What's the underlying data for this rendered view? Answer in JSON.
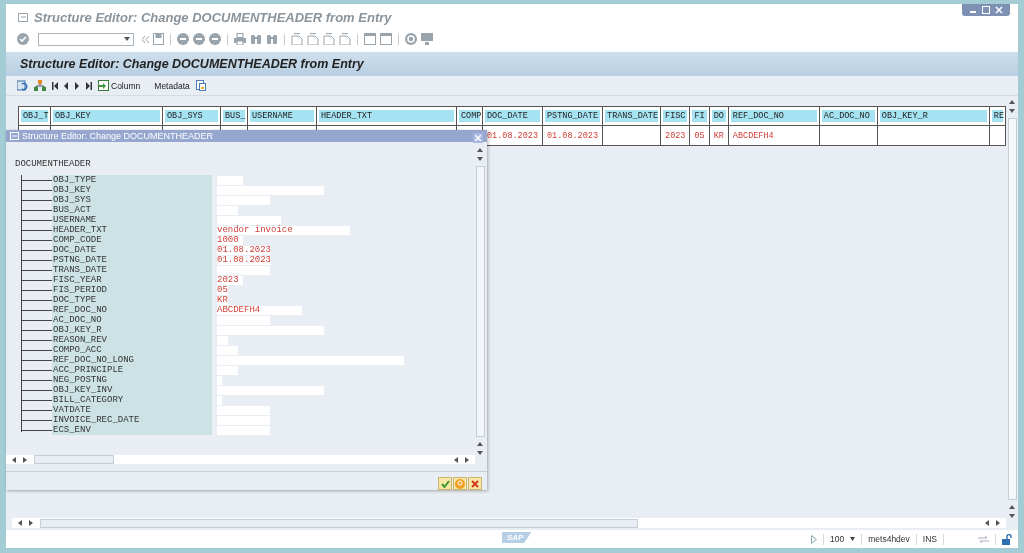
{
  "window": {
    "title": "Structure Editor: Change DOCUMENTHEADER from Entry"
  },
  "screen": {
    "title": "Structure Editor: Change DOCUMENTHEADER from Entry",
    "column_button": "Column",
    "metadata_button": "Metadata"
  },
  "table": {
    "columns": [
      {
        "label": "OBJ_T"
      },
      {
        "label": "OBJ_KEY"
      },
      {
        "label": "OBJ_SYS"
      },
      {
        "label": "BUS_"
      },
      {
        "label": "USERNAME"
      },
      {
        "label": "HEADER_TXT"
      },
      {
        "label": "COMP"
      },
      {
        "label": "DOC_DATE",
        "value": "01.08.2023"
      },
      {
        "label": "PSTNG_DATE",
        "value": "01.08.2023"
      },
      {
        "label": "TRANS_DATE"
      },
      {
        "label": "FISC",
        "value": "2023"
      },
      {
        "label": "FI",
        "value": "05"
      },
      {
        "label": "DO",
        "value": "KR"
      },
      {
        "label": "REF_DOC_NO",
        "value": "ABCDEFH4"
      },
      {
        "label": "AC_DOC_NO"
      },
      {
        "label": "OBJ_KEY_R"
      },
      {
        "label": "RE"
      }
    ]
  },
  "dialog": {
    "title": "Structure Editor: Change DOCUMENTHEADER",
    "root": "DOCUMENTHEADER",
    "children": [
      {
        "name": "OBJ_TYPE"
      },
      {
        "name": "OBJ_KEY"
      },
      {
        "name": "OBJ_SYS"
      },
      {
        "name": "BUS_ACT"
      },
      {
        "name": "USERNAME"
      },
      {
        "name": "HEADER_TXT",
        "value": "vendor invoice"
      },
      {
        "name": "COMP_CODE",
        "value": "1000"
      },
      {
        "name": "DOC_DATE",
        "value": "01.08.2023"
      },
      {
        "name": "PSTNG_DATE",
        "value": "01.08.2023"
      },
      {
        "name": "TRANS_DATE"
      },
      {
        "name": "FISC_YEAR",
        "value": "2023"
      },
      {
        "name": "FIS_PERIOD",
        "value": "05"
      },
      {
        "name": "DOC_TYPE",
        "value": "KR"
      },
      {
        "name": "REF_DOC_NO",
        "value": "ABCDEFH4"
      },
      {
        "name": "AC_DOC_NO"
      },
      {
        "name": "OBJ_KEY_R"
      },
      {
        "name": "REASON_REV"
      },
      {
        "name": "COMPO_ACC"
      },
      {
        "name": "REF_DOC_NO_LONG"
      },
      {
        "name": "ACC_PRINCIPLE"
      },
      {
        "name": "NEG_POSTNG"
      },
      {
        "name": "OBJ_KEY_INV"
      },
      {
        "name": "BILL_CATEGORY"
      },
      {
        "name": "VATDATE"
      },
      {
        "name": "INVOICE_REC_DATE"
      },
      {
        "name": "ECS_ENV"
      }
    ]
  },
  "status_bar": {
    "logo": "SAP",
    "zoom": "100",
    "system": "mets4hdev",
    "mode": "INS"
  }
}
